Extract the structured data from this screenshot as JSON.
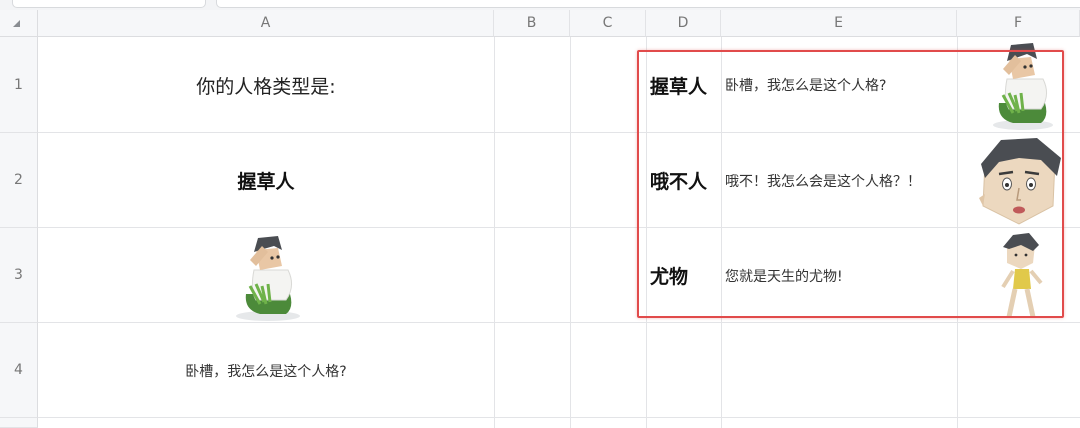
{
  "columns": [
    "A",
    "B",
    "C",
    "D",
    "E",
    "F"
  ],
  "rows": [
    "1",
    "2",
    "3",
    "4"
  ],
  "colors": {
    "highlight_border": "#e14b4b",
    "grid": "#e3e4e7",
    "header_bg": "#f6f7f9"
  },
  "cells": {
    "A1": "你的人格类型是:",
    "A2": "握草人",
    "A3_image": "crouching-man-holding-grass-figure",
    "A4": "卧槽，我怎么是这个人格?",
    "D1": "握草人",
    "E1": "卧槽，我怎么是这个人格?",
    "F1_image": "crouching-man-holding-grass-figure",
    "D2": "哦不人",
    "E2": "哦不！我怎么会是这个人格？！",
    "F2_image": "shocked-face-figure",
    "D3": "尤物",
    "E3": "您就是天生的尤物!",
    "F3_image": "posing-figure-in-yellow-swimsuit"
  }
}
